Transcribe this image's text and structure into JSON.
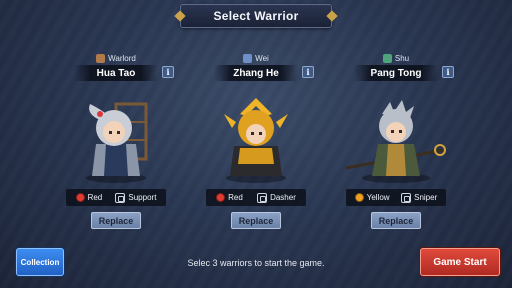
{
  "screen": {
    "title": "Select Warrior",
    "hint": "Selec 3 warriors to start the game.",
    "collection_label": "Collection",
    "start_label": "Game Start"
  },
  "warriors": [
    {
      "faction": "Warlord",
      "faction_color": "#b07a4a",
      "name": "Hua Tao",
      "info_label": "i",
      "color_label": "Red",
      "color_hex": "#e13a2f",
      "role_label": "Support",
      "replace_label": "Replace"
    },
    {
      "faction": "Wei",
      "faction_color": "#6f8fc8",
      "name": "Zhang He",
      "info_label": "i",
      "color_label": "Red",
      "color_hex": "#e13a2f",
      "role_label": "Dasher",
      "replace_label": "Replace"
    },
    {
      "faction": "Shu",
      "faction_color": "#4fa37a",
      "name": "Pang Tong",
      "info_label": "i",
      "color_label": "Yellow",
      "color_hex": "#f0a020",
      "role_label": "Sniper",
      "replace_label": "Replace"
    }
  ],
  "colors": {
    "background": "#2a3752",
    "collection_button": "#2f74dc",
    "start_button": "#c8372c",
    "replace_button": "#7c92b8"
  }
}
